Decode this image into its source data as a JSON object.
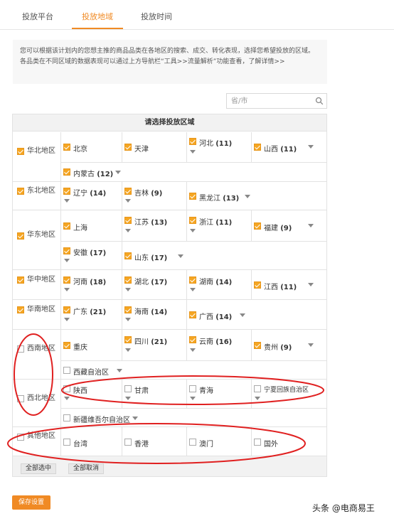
{
  "tabs": [
    {
      "label": "投放平台",
      "active": false
    },
    {
      "label": "投放地域",
      "active": true
    },
    {
      "label": "投放时间",
      "active": false
    }
  ],
  "notice": {
    "text": "您可以根据该计划内的您想主推的商品品类在各地区的搜索、成交、转化表现，选择您希望投放的区域。各品类在不同区域的数据表现可以通过上方导航栏“工具>>流量解析”功能查看，",
    "link": "了解详情>>"
  },
  "search": {
    "placeholder": "省/市",
    "icon": "search-icon"
  },
  "grid": {
    "header": "请选择投放区域",
    "regions": [
      {
        "name": "华北地区",
        "checked": true,
        "provinces": [
          {
            "name": "北京",
            "checked": true
          },
          {
            "name": "天津",
            "checked": true
          },
          {
            "name": "河北",
            "count": "(11)",
            "checked": true
          },
          {
            "name": "山西",
            "count": "(11)",
            "checked": true
          },
          {
            "name": "内蒙古",
            "count": "(12)",
            "checked": true
          }
        ]
      },
      {
        "name": "东北地区",
        "checked": true,
        "provinces": [
          {
            "name": "辽宁",
            "count": "(14)",
            "checked": true
          },
          {
            "name": "吉林",
            "count": "(9)",
            "checked": true
          },
          {
            "name": "黑龙江",
            "count": "(13)",
            "checked": true
          }
        ]
      },
      {
        "name": "华东地区",
        "checked": true,
        "provinces": [
          {
            "name": "上海",
            "checked": true
          },
          {
            "name": "江苏",
            "count": "(13)",
            "checked": true
          },
          {
            "name": "浙江",
            "count": "(11)",
            "checked": true
          },
          {
            "name": "福建",
            "count": "(9)",
            "checked": true
          },
          {
            "name": "安徽",
            "count": "(17)",
            "checked": true
          },
          {
            "name": "山东",
            "count": "(17)",
            "checked": true
          }
        ]
      },
      {
        "name": "华中地区",
        "checked": true,
        "provinces": [
          {
            "name": "河南",
            "count": "(18)",
            "checked": true
          },
          {
            "name": "湖北",
            "count": "(17)",
            "checked": true
          },
          {
            "name": "湖南",
            "count": "(14)",
            "checked": true
          },
          {
            "name": "江西",
            "count": "(11)",
            "checked": true
          }
        ]
      },
      {
        "name": "华南地区",
        "checked": true,
        "provinces": [
          {
            "name": "广东",
            "count": "(21)",
            "checked": true
          },
          {
            "name": "海南",
            "count": "(14)",
            "checked": true
          },
          {
            "name": "广西",
            "count": "(14)",
            "checked": true
          }
        ]
      },
      {
        "name": "西南地区",
        "checked": false,
        "provinces": [
          {
            "name": "重庆",
            "checked": true
          },
          {
            "name": "四川",
            "count": "(21)",
            "checked": true
          },
          {
            "name": "云南",
            "count": "(16)",
            "checked": true
          },
          {
            "name": "贵州",
            "count": "(9)",
            "checked": true
          },
          {
            "name": "西藏自治区",
            "checked": false
          }
        ]
      },
      {
        "name": "西北地区",
        "checked": false,
        "provinces": [
          {
            "name": "陕西",
            "checked": false
          },
          {
            "name": "甘肃",
            "checked": false
          },
          {
            "name": "青海",
            "checked": false
          },
          {
            "name": "宁夏回族自治区",
            "checked": false
          },
          {
            "name": "新疆维吾尔自治区",
            "checked": false
          }
        ]
      },
      {
        "name": "其他地区",
        "checked": false,
        "provinces": [
          {
            "name": "台湾",
            "checked": false
          },
          {
            "name": "香港",
            "checked": false
          },
          {
            "name": "澳门",
            "checked": false
          },
          {
            "name": "国外",
            "checked": false
          }
        ]
      }
    ],
    "select_all_label": "全部选中",
    "deselect_all_label": "全部取消"
  },
  "save_label": "保存设置",
  "watermark": "头条 @电商易王",
  "colors": {
    "accent": "#f08a24",
    "checkbox": "#f5a623",
    "annotation": "#e02020"
  }
}
